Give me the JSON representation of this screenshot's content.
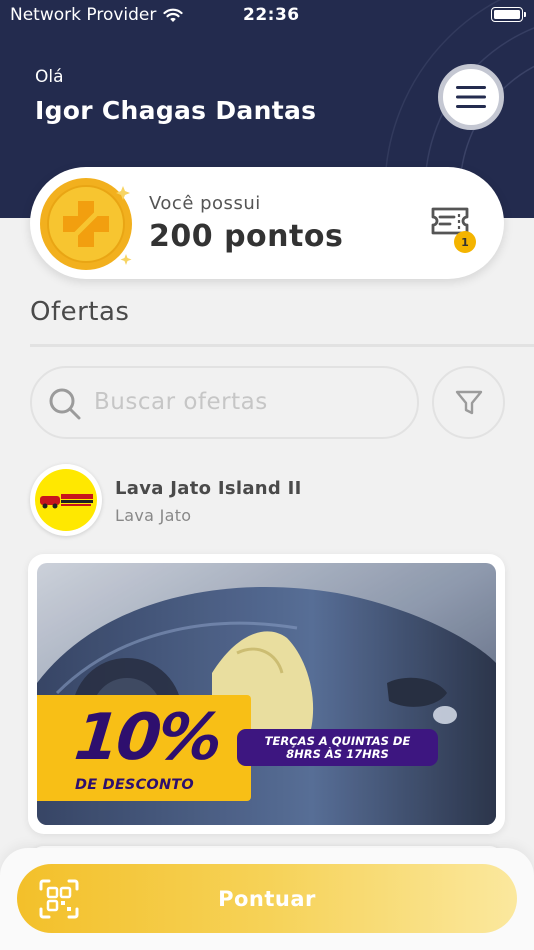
{
  "status_bar": {
    "carrier": "Network Provider",
    "time": "22:36"
  },
  "header": {
    "greeting": "Olá",
    "user_name": "Igor Chagas Dantas"
  },
  "points": {
    "label": "Você possui",
    "value": "200 pontos",
    "ticket_badge": "1"
  },
  "offers": {
    "section_title": "Ofertas",
    "search_placeholder": "Buscar ofertas",
    "stores": [
      {
        "name": "Lava Jato Island II",
        "category": "Lava Jato",
        "offer": {
          "discount": "10%",
          "discount_label": "DE DESCONTO",
          "schedule_line1": "TERÇAS A QUINTAS DE",
          "schedule_line2": "8HRS ÀS 17HRS"
        }
      }
    ]
  },
  "bottom": {
    "button_label": "Pontuar"
  },
  "colors": {
    "header_bg": "#232b4e",
    "accent_yellow": "#f3c02a",
    "offer_purple": "#2e0f6e"
  },
  "icons": [
    "wifi-icon",
    "battery-icon",
    "menu-icon",
    "coin-icon",
    "ticket-icon",
    "search-icon",
    "filter-icon",
    "qr-code-icon"
  ]
}
